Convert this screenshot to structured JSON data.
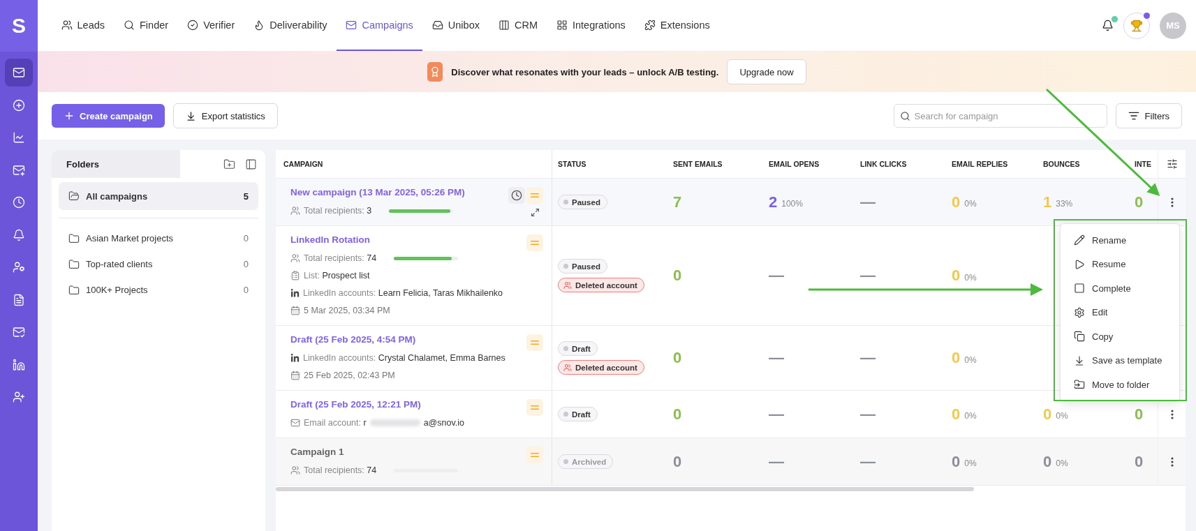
{
  "brand": "S",
  "nav": [
    {
      "label": "Leads",
      "kind": "users",
      "selected": false
    },
    {
      "label": "Finder",
      "kind": "search",
      "selected": false
    },
    {
      "label": "Verifier",
      "kind": "check",
      "selected": false
    },
    {
      "label": "Deliverability",
      "kind": "flame",
      "selected": false
    },
    {
      "label": "Campaigns",
      "kind": "mail",
      "selected": true
    },
    {
      "label": "Unibox",
      "kind": "inbox",
      "selected": false
    },
    {
      "label": "CRM",
      "kind": "columns",
      "selected": false
    },
    {
      "label": "Integrations",
      "kind": "grid",
      "selected": false
    },
    {
      "label": "Extensions",
      "kind": "puzzle",
      "selected": false
    }
  ],
  "user": {
    "initials": "MS"
  },
  "sidebar": [
    {
      "kind": "mail",
      "selected": true
    },
    {
      "kind": "add",
      "selected": false
    },
    {
      "kind": "chart",
      "selected": false
    },
    {
      "kind": "mail-plus",
      "selected": false
    },
    {
      "kind": "clock",
      "selected": false
    },
    {
      "kind": "bell",
      "selected": false
    },
    {
      "kind": "user-card",
      "selected": false
    },
    {
      "kind": "file",
      "selected": false
    },
    {
      "kind": "mail-check",
      "selected": false
    },
    {
      "kind": "linkedin",
      "selected": false
    },
    {
      "kind": "user-plus",
      "selected": false
    }
  ],
  "banner": {
    "text": "Discover what resonates with your leads – unlock A/B testing.",
    "button": "Upgrade now"
  },
  "toolbar": {
    "create": "Create campaign",
    "export": "Export statistics",
    "search": {
      "placeholder": "Search for campaign"
    },
    "filters": "Filters"
  },
  "folders": {
    "title": "Folders",
    "items": [
      {
        "label": "All campaigns",
        "count": "5",
        "selected": true
      },
      {
        "label": "Asian Market projects",
        "count": "0",
        "selected": false
      },
      {
        "label": "Top-rated clients",
        "count": "0",
        "selected": false
      },
      {
        "label": "100K+ Projects",
        "count": "0",
        "selected": false
      }
    ]
  },
  "table": {
    "columns": [
      "CAMPAIGN",
      "STATUS",
      "SENT EMAILS",
      "EMAIL OPENS",
      "LINK CLICKS",
      "EMAIL REPLIES",
      "BOUNCES",
      "INTE"
    ],
    "rows": [
      {
        "name": "New campaign (13 Mar 2025, 05:26 PM)",
        "hovered": true,
        "archived": false,
        "details": [
          {
            "kind": "recipients",
            "label": "Total recipients:",
            "value": "3",
            "level": 0.95
          }
        ],
        "statuses": [
          {
            "kind": "plain",
            "label": "Paused"
          }
        ],
        "metrics": [
          {
            "value": "7"
          },
          {
            "value": "2",
            "percent": "100%"
          },
          {
            "value": "—",
            "kind": "none"
          },
          {
            "value": "0",
            "percent": "0%"
          },
          {
            "value": "1",
            "percent": "33%"
          },
          {
            "value": "0"
          }
        ],
        "menu": true
      },
      {
        "name": "LinkedIn Rotation",
        "hovered": false,
        "archived": false,
        "details": [
          {
            "kind": "recipients",
            "label": "Total recipients:",
            "value": "74",
            "level": 0.9
          },
          {
            "kind": "list",
            "label": "List:",
            "value": "Prospect list"
          },
          {
            "kind": "linkedin",
            "label": "LinkedIn accounts:",
            "value": "Learn Felicia, Taras Mikhailenko"
          },
          {
            "kind": "date",
            "value": "5 Mar 2025, 03:34 PM"
          }
        ],
        "statuses": [
          {
            "kind": "plain",
            "label": "Paused"
          },
          {
            "kind": "deleted",
            "label": "Deleted account"
          }
        ],
        "metrics": [
          {
            "value": "0"
          },
          {
            "value": "—",
            "kind": "none"
          },
          {
            "value": "—",
            "kind": "none"
          },
          {
            "value": "0",
            "percent": "0%"
          }
        ],
        "menu": false
      },
      {
        "name": "Draft (25 Feb 2025, 4:54 PM)",
        "hovered": false,
        "archived": false,
        "details": [
          {
            "kind": "linkedin",
            "label": "LinkedIn accounts:",
            "value": "Crystal Chalamet, Emma Barnes"
          },
          {
            "kind": "date",
            "value": "25 Feb 2025, 02:43 PM"
          }
        ],
        "statuses": [
          {
            "kind": "plain",
            "label": "Draft"
          },
          {
            "kind": "deleted",
            "label": "Deleted account"
          }
        ],
        "metrics": [
          {
            "value": "0"
          },
          {
            "value": "—",
            "kind": "none"
          },
          {
            "value": "—",
            "kind": "none"
          },
          {
            "value": "0",
            "percent": "0%"
          }
        ],
        "menu": false
      },
      {
        "name": "Draft (25 Feb 2025, 12:21 PM)",
        "hovered": false,
        "archived": false,
        "details": [
          {
            "kind": "email",
            "label": "Email account:",
            "value": "r",
            "value_end": "a@snov.io"
          }
        ],
        "statuses": [
          {
            "kind": "plain",
            "label": "Draft"
          }
        ],
        "metrics": [
          {
            "value": "0"
          },
          {
            "value": "—",
            "kind": "none"
          },
          {
            "value": "—",
            "kind": "none"
          },
          {
            "value": "0",
            "percent": "0%"
          },
          {
            "value": "0",
            "percent": "0%"
          },
          {
            "value": "0"
          }
        ],
        "menu": true
      },
      {
        "name": "Campaign 1",
        "hovered": false,
        "archived": true,
        "details": [
          {
            "kind": "recipients",
            "label": "Total recipients:",
            "value": "74"
          }
        ],
        "statuses": [
          {
            "kind": "plain",
            "label": "Archived"
          }
        ],
        "metrics": [
          {
            "value": "0"
          },
          {
            "value": "—",
            "kind": "none"
          },
          {
            "value": "—",
            "kind": "none"
          },
          {
            "value": "0",
            "percent": "0%"
          },
          {
            "value": "0",
            "percent": "0%"
          },
          {
            "value": "0"
          }
        ],
        "menu": true
      }
    ]
  },
  "context_menu": {
    "items": [
      {
        "kind": "rename",
        "label": "Rename"
      },
      {
        "kind": "resume",
        "label": "Resume"
      },
      {
        "kind": "complete",
        "label": "Complete"
      },
      {
        "kind": "edit",
        "label": "Edit"
      },
      {
        "kind": "copy",
        "label": "Copy"
      },
      {
        "kind": "template",
        "label": "Save as template"
      },
      {
        "kind": "move",
        "label": "Move to folder"
      }
    ]
  }
}
